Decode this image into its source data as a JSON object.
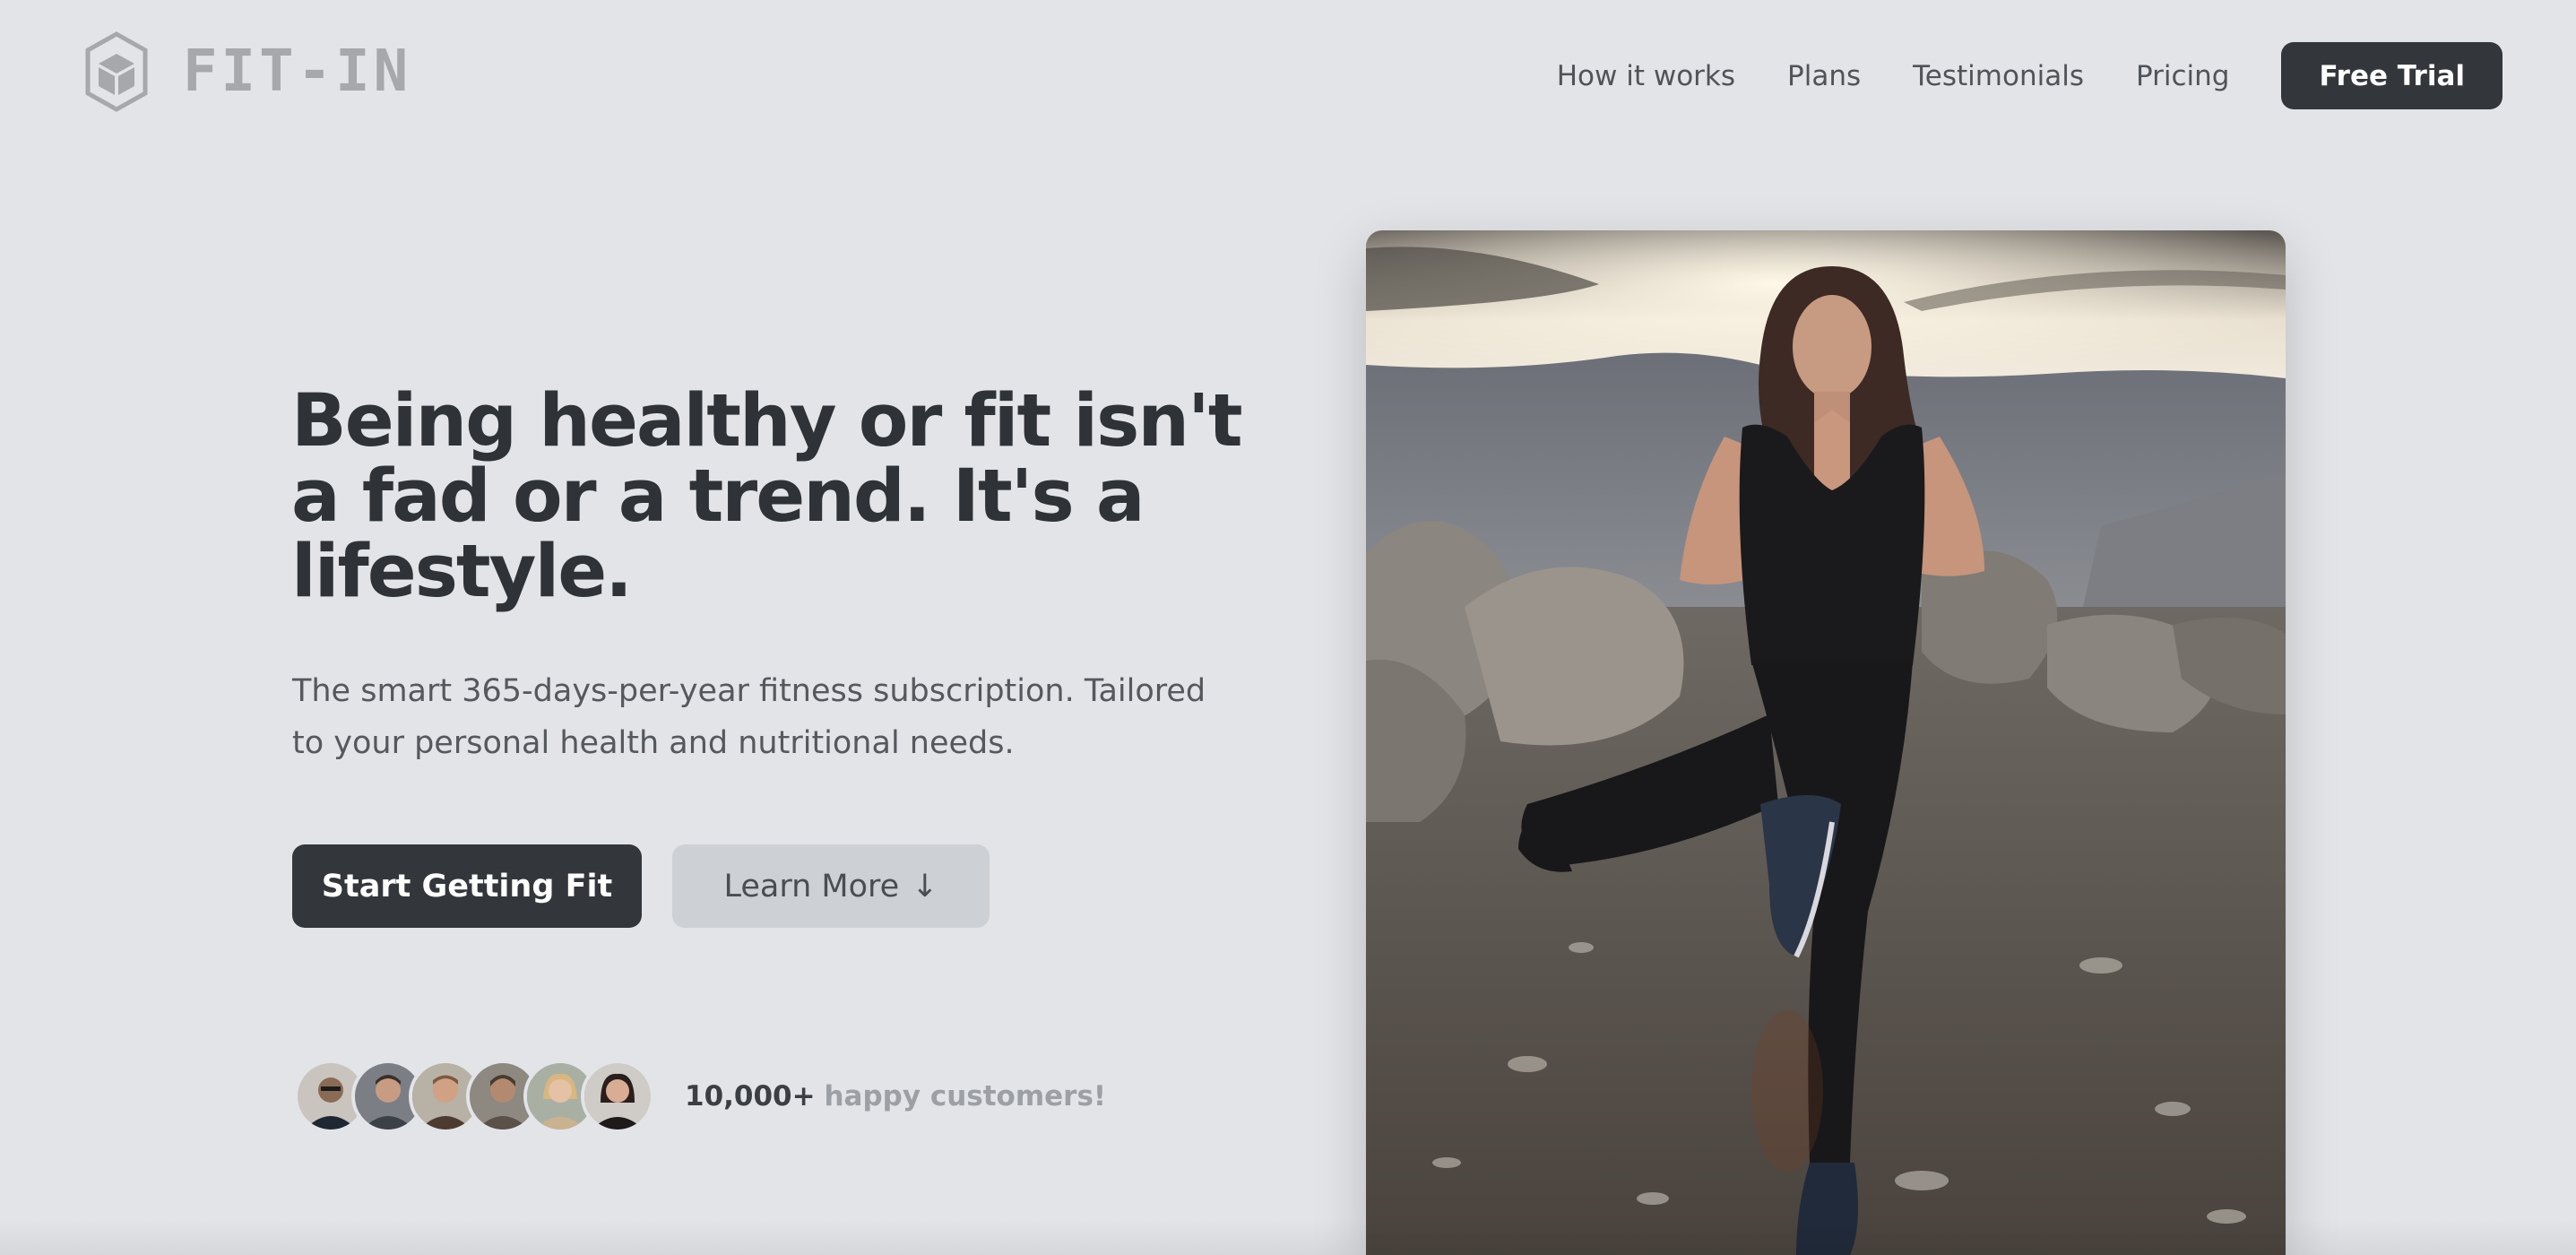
{
  "brand": {
    "name": "FIT-IN"
  },
  "nav": {
    "items": [
      {
        "label": "How it works"
      },
      {
        "label": "Plans"
      },
      {
        "label": "Testimonials"
      },
      {
        "label": "Pricing"
      }
    ],
    "cta_label": "Free Trial"
  },
  "hero": {
    "title": "Being healthy or fit isn't a fad or a trend. It's a lifestyle.",
    "subtitle": "The smart 365-days-per-year fitness subscription. Tailored to your personal health and nutritional needs.",
    "primary_button": "Start Getting Fit",
    "secondary_button": "Learn More",
    "secondary_button_icon": "arrow-down-icon"
  },
  "social_proof": {
    "count": "10,000+",
    "label": "happy customers!",
    "avatar_count": 6
  },
  "colors": {
    "background": "#e2e4e8",
    "primary_button": "#33373b",
    "secondary_button": "#cdd0d4",
    "heading_text": "#2f3236",
    "muted_text": "#9c9fa3"
  }
}
